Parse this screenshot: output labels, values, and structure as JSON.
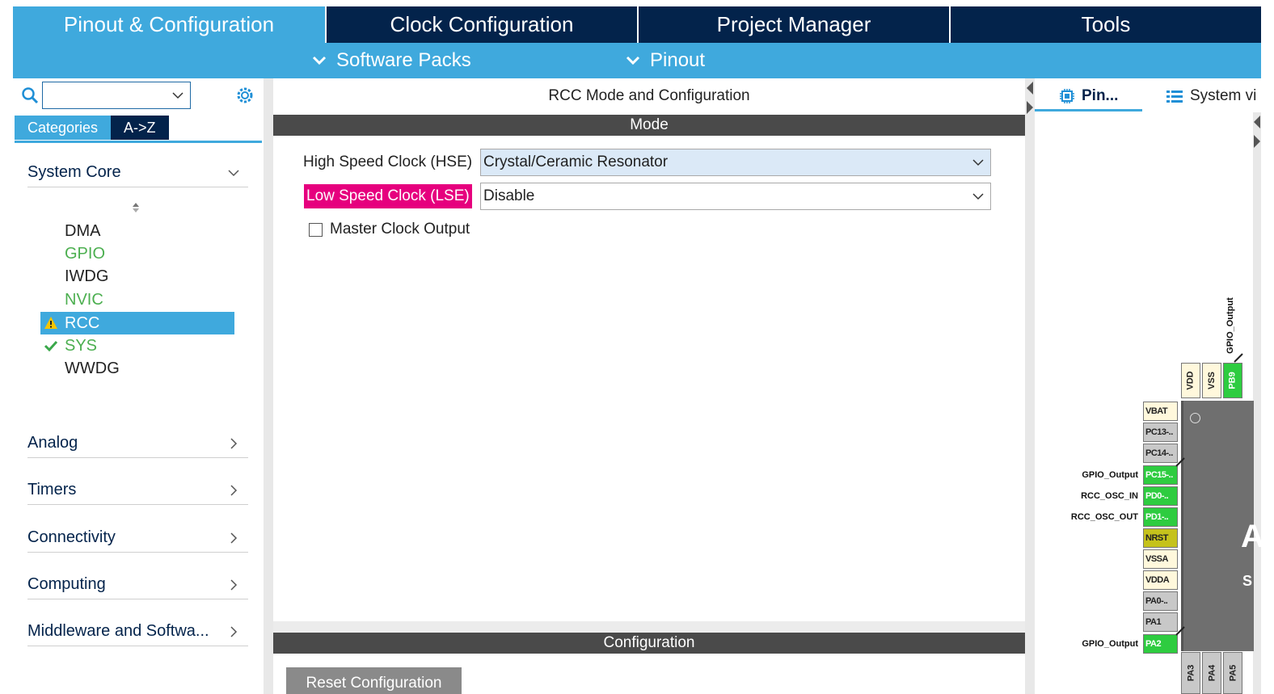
{
  "top_tabs": [
    {
      "label": "Pinout & Configuration"
    },
    {
      "label": "Clock Configuration"
    },
    {
      "label": "Project Manager"
    },
    {
      "label": "Tools"
    }
  ],
  "sub_bar": {
    "software_packs": "Software Packs",
    "pinout": "Pinout"
  },
  "left": {
    "search": {
      "value": ""
    },
    "tabs": {
      "categories": "Categories",
      "az": "A->Z"
    },
    "system_core": {
      "label": "System Core",
      "items": [
        {
          "label": "DMA",
          "status": "none"
        },
        {
          "label": "GPIO",
          "status": "configured"
        },
        {
          "label": "IWDG",
          "status": "none"
        },
        {
          "label": "NVIC",
          "status": "configured"
        },
        {
          "label": "RCC",
          "status": "warning"
        },
        {
          "label": "SYS",
          "status": "ok"
        },
        {
          "label": "WWDG",
          "status": "none"
        }
      ]
    },
    "groups": [
      {
        "label": "Analog"
      },
      {
        "label": "Timers"
      },
      {
        "label": "Connectivity"
      },
      {
        "label": "Computing"
      },
      {
        "label": "Middleware and Softwa..."
      }
    ]
  },
  "center": {
    "title": "RCC Mode and Configuration",
    "mode_header": "Mode",
    "hse": {
      "label": "High Speed Clock (HSE)",
      "value": "Crystal/Ceramic Resonator"
    },
    "lse": {
      "label": "Low Speed Clock (LSE)",
      "value": "Disable"
    },
    "mco": {
      "label": "Master Clock Output",
      "checked": false
    },
    "config_header": "Configuration",
    "reset_button": "Reset Configuration"
  },
  "right": {
    "tabs": {
      "pinout_view": "Pin...",
      "system_view": "System vi"
    },
    "top_pins": [
      {
        "label": "VDD",
        "color": "beige"
      },
      {
        "label": "VSS",
        "color": "beige"
      },
      {
        "label": "PB9",
        "color": "green"
      }
    ],
    "top_signal": "GPIO_Output",
    "left_pins": [
      {
        "label": "VBAT",
        "color": "beige",
        "signal": ""
      },
      {
        "label": "PC13-..",
        "color": "grey",
        "signal": ""
      },
      {
        "label": "PC14-..",
        "color": "grey",
        "signal": ""
      },
      {
        "label": "PC15-..",
        "color": "green",
        "signal": "GPIO_Output"
      },
      {
        "label": "PD0-..",
        "color": "green",
        "signal": "RCC_OSC_IN"
      },
      {
        "label": "PD1-..",
        "color": "green",
        "signal": "RCC_OSC_OUT"
      },
      {
        "label": "NRST",
        "color": "olive",
        "signal": ""
      },
      {
        "label": "VSSA",
        "color": "beige",
        "signal": ""
      },
      {
        "label": "VDDA",
        "color": "beige",
        "signal": ""
      },
      {
        "label": "PA0-..",
        "color": "grey",
        "signal": ""
      },
      {
        "label": "PA1",
        "color": "grey",
        "signal": ""
      },
      {
        "label": "PA2",
        "color": "green",
        "signal": "GPIO_Output"
      }
    ],
    "bottom_pins": [
      {
        "label": "PA3"
      },
      {
        "label": "PA4"
      },
      {
        "label": "PA5"
      }
    ],
    "chip_text": {
      "a": "A",
      "b": "S"
    }
  }
}
